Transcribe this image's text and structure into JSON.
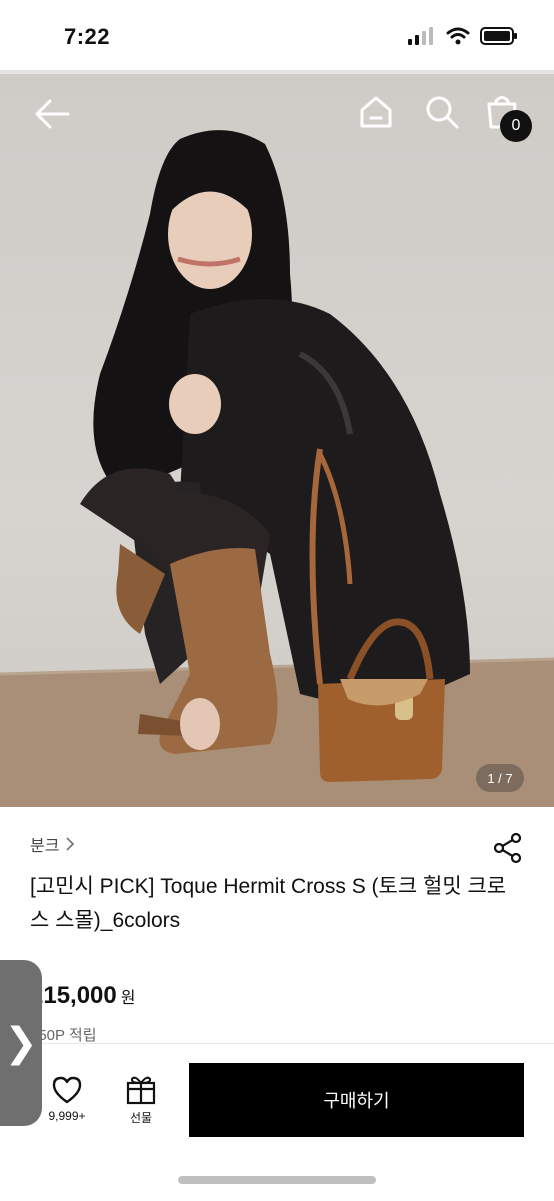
{
  "status_bar": {
    "time": "7:22"
  },
  "hero": {
    "image_description_name": "product-photo",
    "counter": "1 / 7",
    "cart_count": "0"
  },
  "product": {
    "brand": "분크",
    "title": "[고민시 PICK] Toque Hermit Cross S (토크 헐밋 크로스 스몰)_6colors",
    "price": "215,000",
    "price_unit": "원",
    "points": "150P 적립"
  },
  "bottom_bar": {
    "like_count": "9,999+",
    "gift_label": "선물",
    "buy_label": "구매하기"
  },
  "side_tab": {
    "glyph": "❯"
  },
  "icons": [
    "back-arrow-icon",
    "home-icon",
    "search-icon",
    "shopping-bag-icon",
    "share-icon",
    "heart-icon",
    "gift-icon"
  ]
}
